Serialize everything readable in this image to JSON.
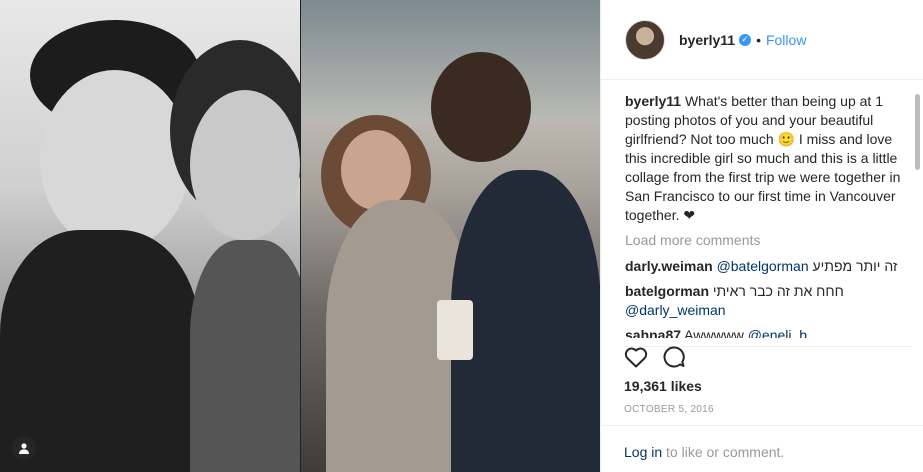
{
  "post": {
    "username": "byerly11",
    "follow_label": "Follow",
    "separator": "•",
    "caption": "What's better than being up at 1 posting photos of you and your beautiful girlfriend? Not too much 🙂 I miss and love this incredible girl so much and this is a little collage from the first trip we were together in San Francisco to our first time in Vancouver together. ❤",
    "load_more": "Load more comments",
    "comments": [
      {
        "user": "darly.weiman",
        "mention": "@batelgorman",
        "text": "זה יותר מפתיע"
      },
      {
        "user": "batelgorman",
        "text": "חחח את זה כבר ראיתי",
        "mention": "@darly_weiman"
      },
      {
        "user": "sahna87",
        "text": "Awwwww",
        "mention": "@eneli_b"
      }
    ],
    "likes": "19,361 likes",
    "date": "OCTOBER 5, 2016",
    "login_link": "Log in",
    "login_rest": "to like or comment."
  },
  "icons": {
    "verified": "verified-badge-icon",
    "like": "heart-icon",
    "comment": "comment-bubble-icon",
    "user_tag": "user-tag-icon"
  },
  "colors": {
    "link": "#3897f0",
    "mention": "#003569",
    "muted": "#999999",
    "text": "#262626"
  }
}
